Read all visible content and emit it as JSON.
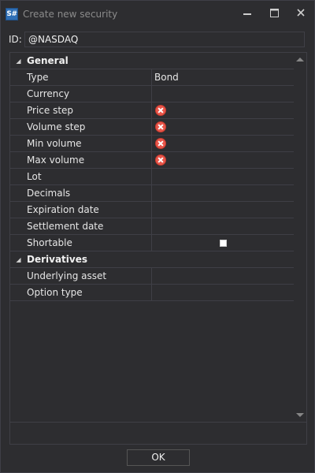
{
  "window": {
    "title": "Create new security",
    "app_icon_text": "S#",
    "buttons": {
      "minimize": "minimize-icon",
      "maximize": "maximize-icon",
      "close": "close-icon"
    }
  },
  "id_field": {
    "label": "ID:",
    "value": "@NASDAQ"
  },
  "grid": {
    "categories": [
      {
        "name": "General",
        "rows": [
          {
            "name": "Type",
            "value": "Bond"
          },
          {
            "name": "Currency",
            "value": ""
          },
          {
            "name": "Price step",
            "value": "",
            "status": "error-icon"
          },
          {
            "name": "Volume step",
            "value": "",
            "status": "error-icon"
          },
          {
            "name": "Min volume",
            "value": "",
            "status": "error-icon"
          },
          {
            "name": "Max volume",
            "value": "",
            "status": "error-icon"
          },
          {
            "name": "Lot",
            "value": ""
          },
          {
            "name": "Decimals",
            "value": ""
          },
          {
            "name": "Expiration date",
            "value": ""
          },
          {
            "name": "Settlement date",
            "value": ""
          },
          {
            "name": "Shortable",
            "value": "",
            "checked": false
          }
        ]
      },
      {
        "name": "Derivatives",
        "rows": [
          {
            "name": "Underlying asset",
            "value": ""
          },
          {
            "name": "Option type",
            "value": ""
          }
        ]
      }
    ]
  },
  "footer": {
    "ok_label": "OK"
  },
  "colors": {
    "background": "#2d2d30",
    "border": "#3f3f46",
    "error": "#e8564a",
    "accent": "#2f6fb6"
  }
}
